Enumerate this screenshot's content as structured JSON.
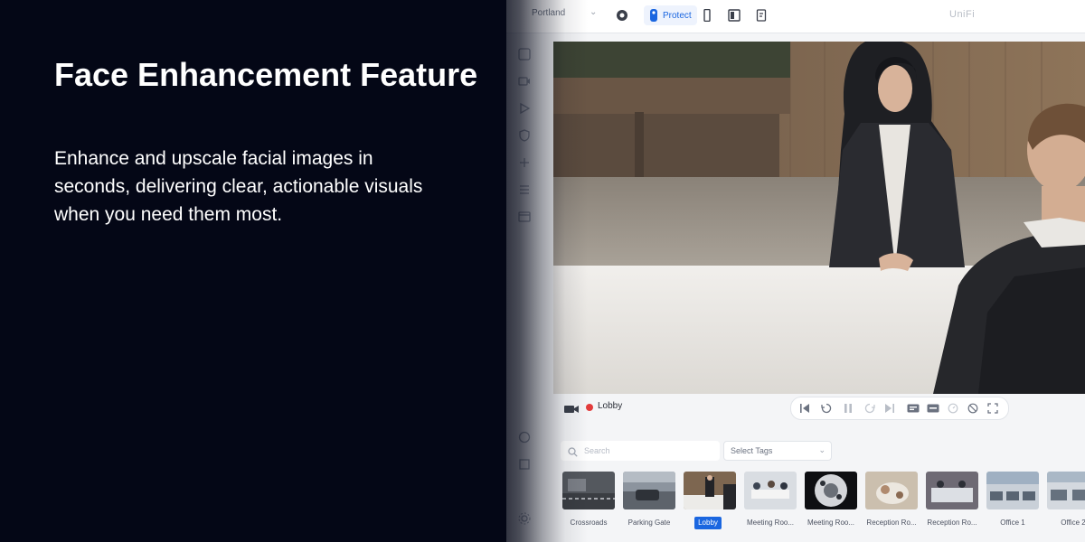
{
  "marketing": {
    "headline": "Face Enhancement Feature",
    "description": "Enhance and upscale facial images in seconds, delivering clear, actionable visuals when you need them most."
  },
  "app": {
    "site_selector": "Portland",
    "active_app": "Protect",
    "brand": "UniFi",
    "accent_color": "#1a66e0",
    "camera": {
      "name": "Lobby",
      "recording": true
    },
    "search": {
      "placeholder": "Search",
      "value": ""
    },
    "tags_select": {
      "label": "Select Tags"
    },
    "thumbnails": [
      {
        "label": "Crossroads",
        "selected": false
      },
      {
        "label": "Parking Gate",
        "selected": false
      },
      {
        "label": "Lobby",
        "selected": true
      },
      {
        "label": "Meeting Roo...",
        "selected": false
      },
      {
        "label": "Meeting Roo...",
        "selected": false
      },
      {
        "label": "Reception Ro...",
        "selected": false
      },
      {
        "label": "Reception Ro...",
        "selected": false
      },
      {
        "label": "Office 1",
        "selected": false
      },
      {
        "label": "Office 2",
        "selected": false
      }
    ]
  }
}
